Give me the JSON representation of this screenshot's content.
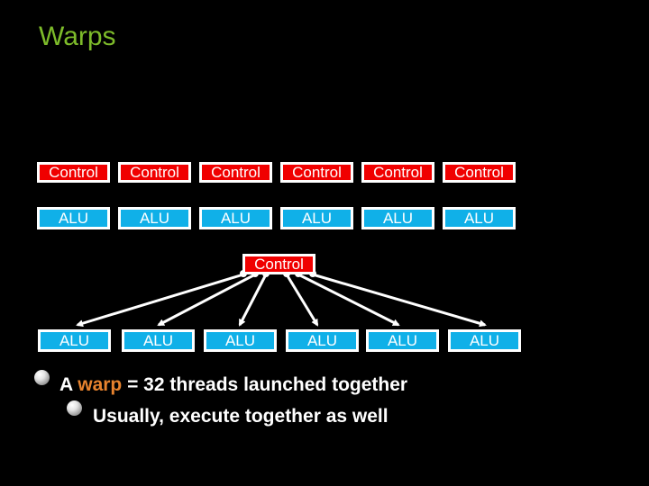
{
  "slide": {
    "title": "Warps",
    "title_color": "#7dbb2a"
  },
  "top_grid": {
    "control_labels": [
      "Control",
      "Control",
      "Control",
      "Control",
      "Control",
      "Control"
    ],
    "alu_labels": [
      "ALU",
      "ALU",
      "ALU",
      "ALU",
      "ALU",
      "ALU"
    ]
  },
  "shared_warp": {
    "control_label": "Control",
    "alu_labels": [
      "ALU",
      "ALU",
      "ALU",
      "ALU",
      "ALU",
      "ALU"
    ]
  },
  "colors": {
    "control": "#f00000",
    "alu": "#10b0e8",
    "accent": "#e8832e"
  },
  "bullets": [
    {
      "prefix": "A ",
      "highlight": "warp",
      "suffix": " = 32 threads launched together"
    },
    {
      "text": "Usually, execute together as well"
    }
  ]
}
